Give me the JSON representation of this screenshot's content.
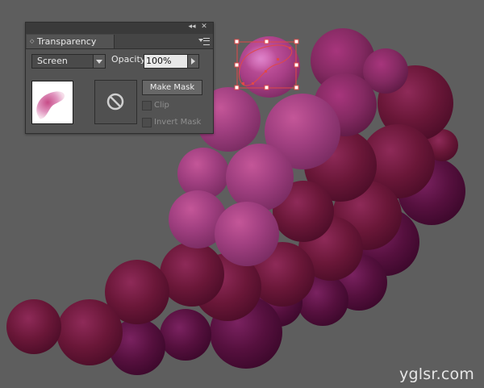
{
  "panel": {
    "tab_label": "Transparency",
    "title_collapse_glyph": "◂◂",
    "title_close_glyph": "✕",
    "tab_updown_glyph": "◇",
    "menu_icon": "panel-menu-icon",
    "blend_mode": "Screen",
    "opacity_label": "Opacity:",
    "opacity_value": "100%",
    "make_mask_label": "Make Mask",
    "clip_label": "Clip",
    "invert_mask_label": "Invert Mask",
    "clip_checked": false,
    "invert_checked": false,
    "mask_placeholder_icon": "no-symbol-icon"
  },
  "canvas": {
    "background": "#5e5e5e",
    "grape_palette": [
      "#a73c85",
      "#8e2c68",
      "#6e1840",
      "#4f0e3f",
      "#d365ad"
    ],
    "selection_color": "#e04848"
  },
  "watermark": "yglsr.com"
}
